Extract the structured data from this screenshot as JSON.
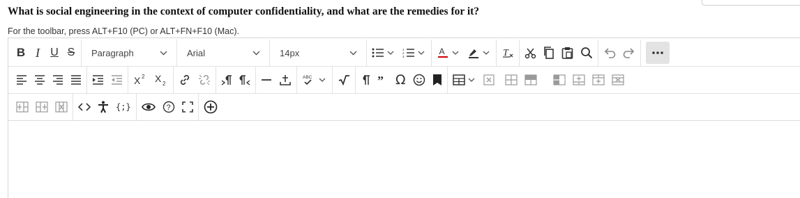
{
  "question": "What is social engineering in the context of computer confidentiality, and what are the remedies for it?",
  "toolbar_hint": "For the toolbar, press ALT+F10 (PC) or ALT+FN+F10 (Mac).",
  "format_dropdown": "Paragraph",
  "font_dropdown": "Arial",
  "size_dropdown": "14px",
  "editor_body": ""
}
